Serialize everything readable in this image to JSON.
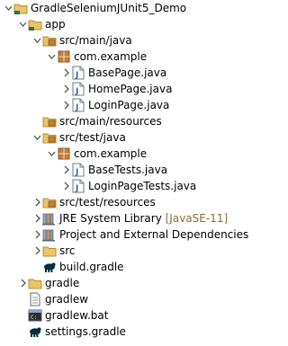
{
  "tree": {
    "rows": [
      {
        "label": "GradleSeleniumJUnit5_Demo",
        "icon": "gradle-project-folder-icon",
        "expanded": true
      },
      {
        "label": "app",
        "icon": "gradle-project-folder-icon",
        "expanded": true
      },
      {
        "label": "src/main/java",
        "icon": "source-folder-icon",
        "expanded": true
      },
      {
        "label": "com.example",
        "icon": "package-icon",
        "expanded": true
      },
      {
        "label": "BasePage.java",
        "icon": "java-file-icon",
        "expanded": false
      },
      {
        "label": "HomePage.java",
        "icon": "java-file-icon",
        "expanded": false
      },
      {
        "label": "LoginPage.java",
        "icon": "java-file-icon",
        "expanded": false
      },
      {
        "label": "src/main/resources",
        "icon": "source-folder-icon",
        "expanded": null
      },
      {
        "label": "src/test/java",
        "icon": "source-folder-icon",
        "expanded": true
      },
      {
        "label": "com.example",
        "icon": "package-icon",
        "expanded": true
      },
      {
        "label": "BaseTests.java",
        "icon": "java-file-icon",
        "expanded": false
      },
      {
        "label": "LoginPageTests.java",
        "icon": "java-file-icon",
        "expanded": false
      },
      {
        "label": "src/test/resources",
        "icon": "source-folder-icon",
        "expanded": false
      },
      {
        "label": "JRE System Library",
        "suffix": "[JavaSE-11]",
        "icon": "library-icon",
        "expanded": false
      },
      {
        "label": "Project and External Dependencies",
        "icon": "library-icon",
        "expanded": false
      },
      {
        "label": "src",
        "icon": "folder-icon",
        "expanded": false
      },
      {
        "label": "build.gradle",
        "icon": "gradle-file-icon",
        "expanded": null
      },
      {
        "label": "gradle",
        "icon": "folder-icon",
        "expanded": false
      },
      {
        "label": "gradlew",
        "icon": "text-file-icon",
        "expanded": null
      },
      {
        "label": "gradlew.bat",
        "icon": "bat-file-icon",
        "expanded": null
      },
      {
        "label": "settings.gradle",
        "icon": "gradle-file-icon",
        "expanded": null
      }
    ]
  },
  "colors": {
    "folder": "#e8c46a",
    "folder_dark": "#b98f2f",
    "package": "#c2803a",
    "java_blue": "#3a63b5",
    "library": "#7a8ea8",
    "gradle": "#02303a",
    "suffix": "#8a6a35",
    "twistie": "#555555"
  }
}
